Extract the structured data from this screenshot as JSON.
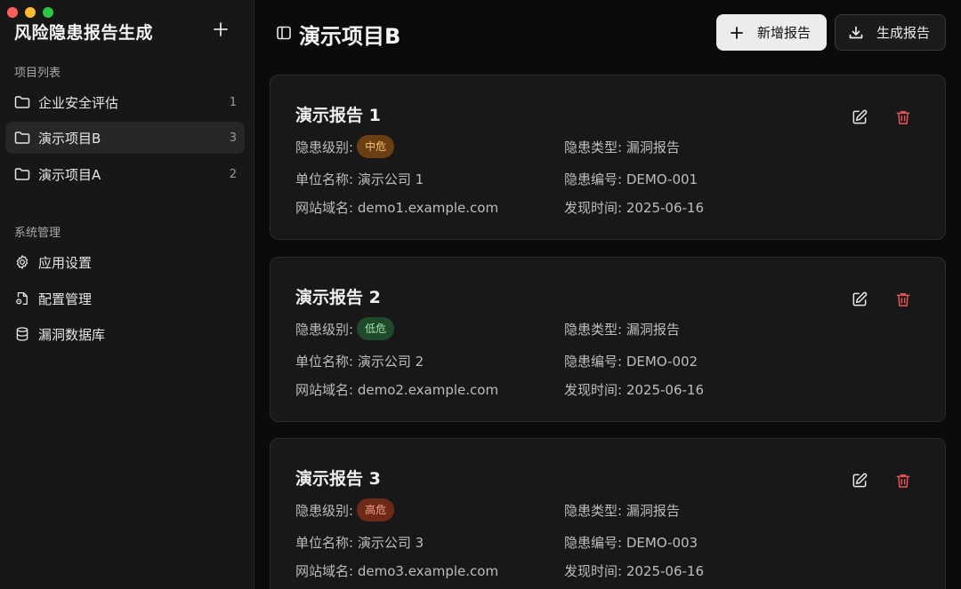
{
  "app": {
    "title": "风险隐患报告生成"
  },
  "window": {
    "colors": [
      "#ff5f57",
      "#febc2e",
      "#28c840"
    ]
  },
  "sidebar": {
    "projects_label": "项目列表",
    "projects": [
      {
        "label": "企业安全评估",
        "count": "1",
        "active": false
      },
      {
        "label": "演示项目B",
        "count": "3",
        "active": true
      },
      {
        "label": "演示项目A",
        "count": "2",
        "active": false
      }
    ],
    "system_label": "系统管理",
    "system_items": [
      {
        "label": "应用设置",
        "icon": "gear-icon"
      },
      {
        "label": "配置管理",
        "icon": "file-settings-icon"
      },
      {
        "label": "漏洞数据库",
        "icon": "database-icon"
      }
    ]
  },
  "header": {
    "title": "演示项目B",
    "add_label": "新增报告",
    "generate_label": "生成报告"
  },
  "labels": {
    "level": "隐患级别:",
    "type": "隐患类型:",
    "unit": "单位名称:",
    "code": "隐患编号:",
    "domain": "网站域名:",
    "time": "发现时间:"
  },
  "level_colors": {
    "中危": {
      "bg": "#6b3f12",
      "fg": "#f3c27a"
    },
    "低危": {
      "bg": "#1f4a2a",
      "fg": "#9fe0b0"
    },
    "高危": {
      "bg": "#6e2a17",
      "fg": "#f0a48a"
    }
  },
  "reports": [
    {
      "title": "演示报告 1",
      "level": "中危",
      "type": "漏洞报告",
      "unit": "演示公司 1",
      "code": "DEMO-001",
      "domain": "demo1.example.com",
      "time": "2025-06-16"
    },
    {
      "title": "演示报告 2",
      "level": "低危",
      "type": "漏洞报告",
      "unit": "演示公司 2",
      "code": "DEMO-002",
      "domain": "demo2.example.com",
      "time": "2025-06-16"
    },
    {
      "title": "演示报告 3",
      "level": "高危",
      "type": "漏洞报告",
      "unit": "演示公司 3",
      "code": "DEMO-003",
      "domain": "demo3.example.com",
      "time": "2025-06-16"
    }
  ]
}
